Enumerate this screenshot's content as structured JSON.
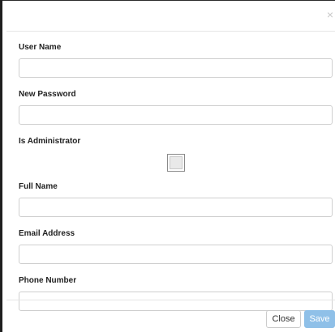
{
  "dialog": {
    "close_glyph": "×"
  },
  "form": {
    "username_label": "User Name",
    "username_value": "",
    "password_label": "New Password",
    "password_value": "",
    "is_admin_label": "Is Administrator",
    "is_admin_checked": false,
    "fullname_label": "Full Name",
    "fullname_value": "",
    "email_label": "Email Address",
    "email_value": "",
    "phone_label": "Phone Number",
    "phone_value": ""
  },
  "footer": {
    "close_label": "Close",
    "save_label": "Save",
    "save_color": "#8fc0e8"
  }
}
